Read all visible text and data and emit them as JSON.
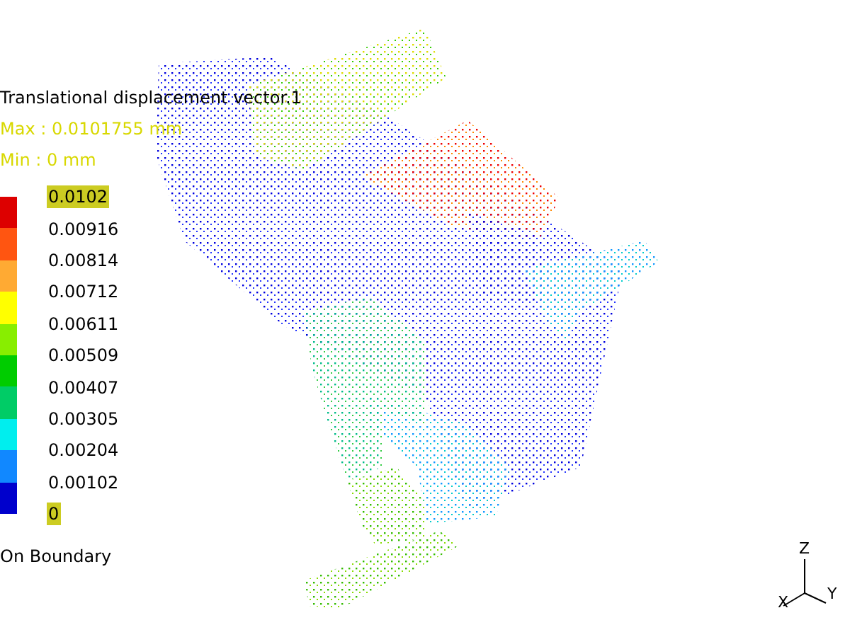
{
  "legend": {
    "title": "Translational displacement vector.1",
    "max": "Max : 0.0101755 mm",
    "min": "Min : 0 mm",
    "levels": [
      {
        "label": "0.0102",
        "highlighted": true
      },
      {
        "label": "0.00916",
        "highlighted": false
      },
      {
        "label": "0.00814",
        "highlighted": false
      },
      {
        "label": "0.00712",
        "highlighted": false
      },
      {
        "label": "0.00611",
        "highlighted": false
      },
      {
        "label": "0.00509",
        "highlighted": false
      },
      {
        "label": "0.00407",
        "highlighted": false
      },
      {
        "label": "0.00305",
        "highlighted": false
      },
      {
        "label": "0.00204",
        "highlighted": false
      },
      {
        "label": "0.00102",
        "highlighted": false
      },
      {
        "label": "0",
        "highlighted": true
      }
    ],
    "bands": [
      {
        "color": "#dd0000"
      },
      {
        "color": "#ff5511"
      },
      {
        "color": "#ffaa33"
      },
      {
        "color": "#ffff00"
      },
      {
        "color": "#88ee00"
      },
      {
        "color": "#00cc00"
      },
      {
        "color": "#00cc66"
      },
      {
        "color": "#00eeee"
      },
      {
        "color": "#1188ff"
      },
      {
        "color": "#0000cc"
      }
    ],
    "boundary": "On Boundary"
  },
  "axes": {
    "z": "Z",
    "y": "Y",
    "x": "X"
  }
}
